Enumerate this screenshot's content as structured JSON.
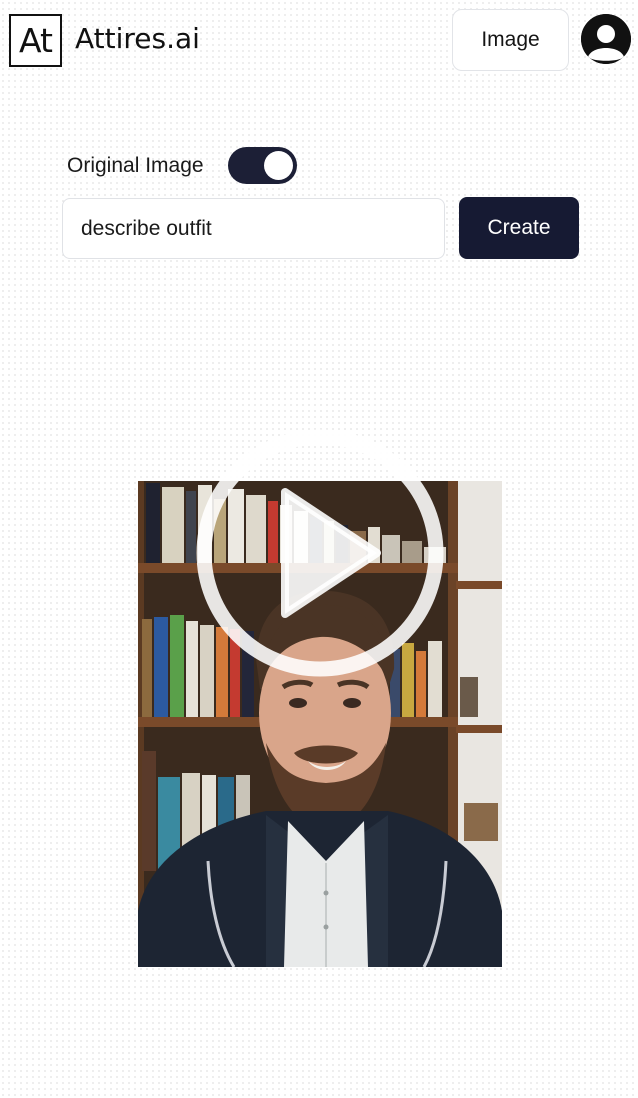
{
  "header": {
    "logo_mark": "At",
    "brand_name": "Attires.ai",
    "mode_button_label": "Image",
    "avatar_icon": "user-account-icon"
  },
  "controls": {
    "toggle_label": "Original Image",
    "toggle_state": "on",
    "prompt_value": "describe outfit",
    "create_label": "Create"
  },
  "video": {
    "play_icon": "play-icon",
    "state": "paused"
  },
  "colors": {
    "primary_dark": "#161a33",
    "toggle_on": "#1c1f36",
    "text": "#111111"
  }
}
